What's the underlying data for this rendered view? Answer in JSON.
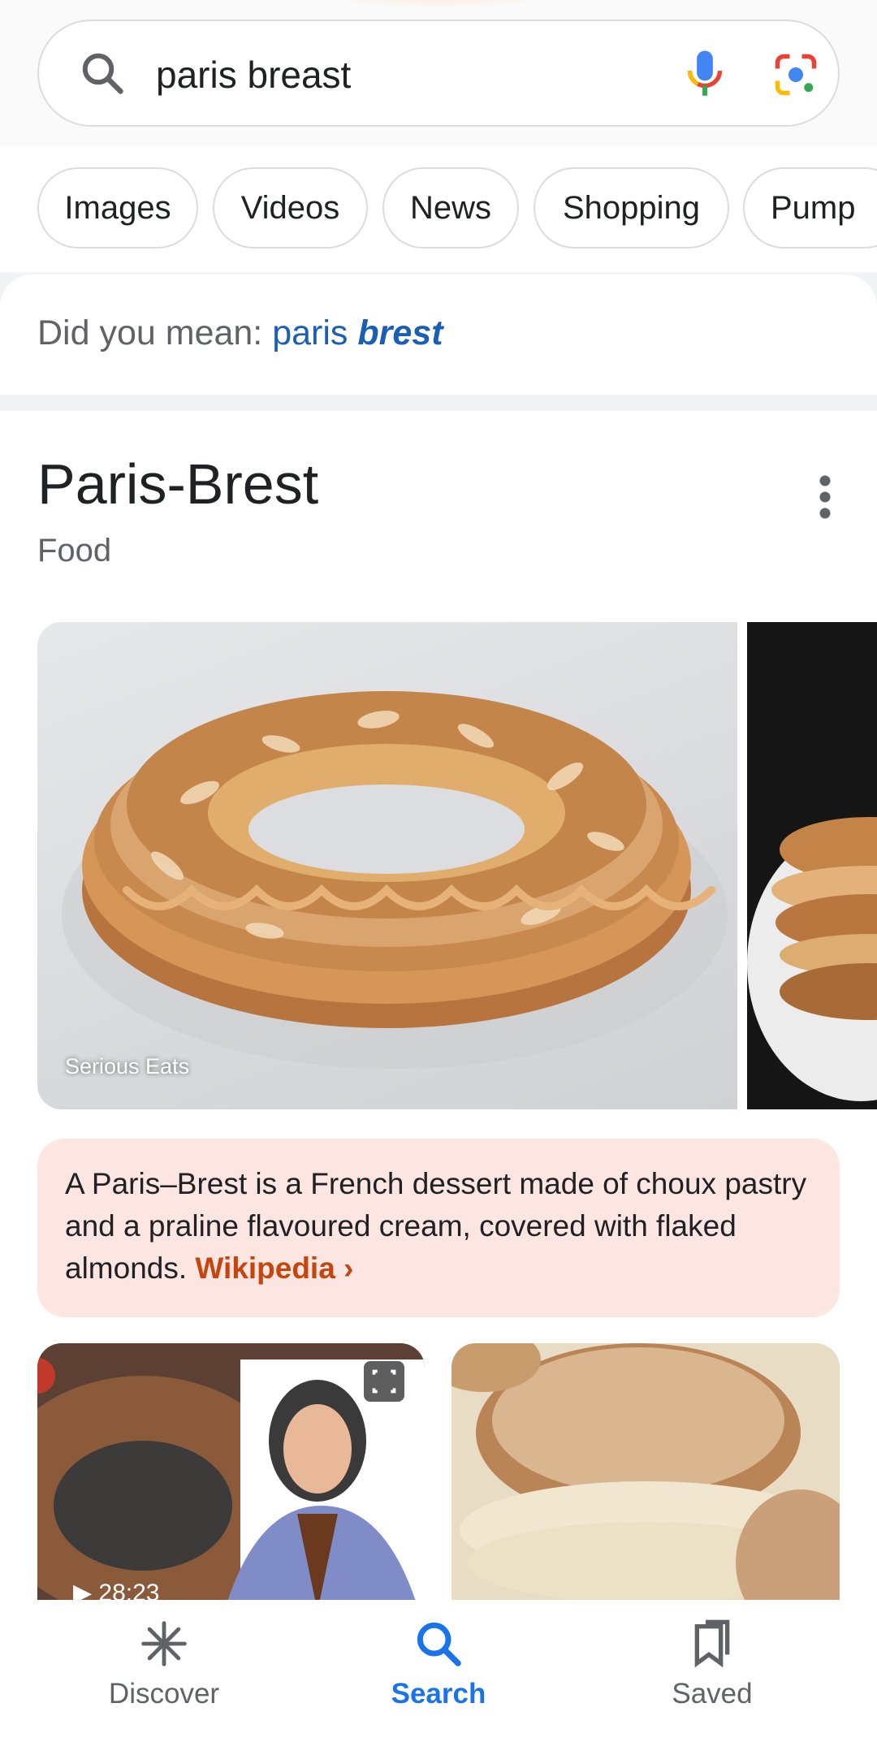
{
  "search": {
    "query": "paris breast",
    "icons": [
      "search-icon",
      "mic-icon",
      "lens-icon"
    ]
  },
  "chips": [
    "Images",
    "Videos",
    "News",
    "Shopping",
    "Pump"
  ],
  "did_you_mean": {
    "prefix": "Did you mean:",
    "link_plain": "paris",
    "link_bold": "brest"
  },
  "knowledge_panel": {
    "title": "Paris-Brest",
    "subtitle": "Food",
    "image_credit": "Serious Eats",
    "description": "A Paris–Brest is a French dessert made of choux pastry and a praline flavoured cream, covered with flaked almonds.",
    "source_link": "Wikipedia",
    "video_duration": "28:23"
  },
  "bottom_nav": {
    "discover": "Discover",
    "search": "Search",
    "saved": "Saved"
  },
  "colors": {
    "accent_blue": "#1a73e8",
    "link_blue": "#1a5fb4",
    "wiki_orange": "#c5450f",
    "desc_bg": "#fde6e1"
  }
}
